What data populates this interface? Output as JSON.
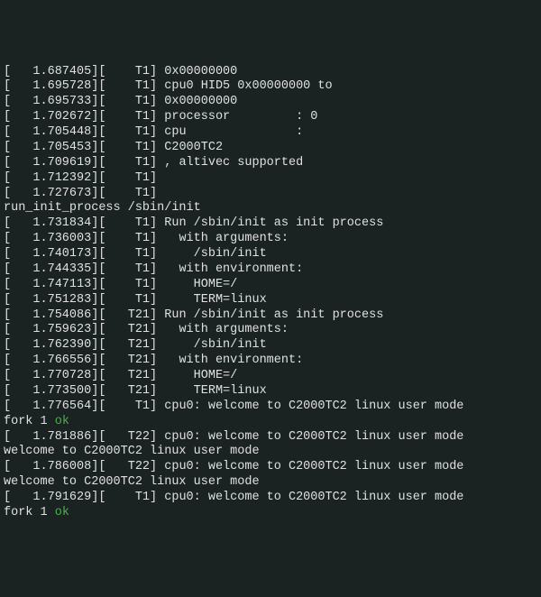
{
  "lines": [
    {
      "type": "log",
      "ts": "1.687405",
      "thread": "T1",
      "msg": "0x00000000"
    },
    {
      "type": "log",
      "ts": "1.695728",
      "thread": "T1",
      "msg": "cpu0 HID5 0x00000000 to"
    },
    {
      "type": "log",
      "ts": "1.695733",
      "thread": "T1",
      "msg": "0x00000000"
    },
    {
      "type": "log",
      "ts": "1.702672",
      "thread": "T1",
      "msg": "processor         : 0"
    },
    {
      "type": "log",
      "ts": "1.705448",
      "thread": "T1",
      "msg": "cpu               :"
    },
    {
      "type": "log",
      "ts": "1.705453",
      "thread": "T1",
      "msg": "C2000TC2"
    },
    {
      "type": "log",
      "ts": "1.709619",
      "thread": "T1",
      "msg": ", altivec supported"
    },
    {
      "type": "log",
      "ts": "1.712392",
      "thread": "T1",
      "msg": ""
    },
    {
      "type": "log",
      "ts": "1.727673",
      "thread": "T1",
      "msg": ""
    },
    {
      "type": "plain",
      "text": "run_init_process /sbin/init"
    },
    {
      "type": "log",
      "ts": "1.731834",
      "thread": "T1",
      "msg": "Run /sbin/init as init process"
    },
    {
      "type": "log",
      "ts": "1.736003",
      "thread": "T1",
      "msg": "  with arguments:"
    },
    {
      "type": "log",
      "ts": "1.740173",
      "thread": "T1",
      "msg": "    /sbin/init"
    },
    {
      "type": "log",
      "ts": "1.744335",
      "thread": "T1",
      "msg": "  with environment:"
    },
    {
      "type": "log",
      "ts": "1.747113",
      "thread": "T1",
      "msg": "    HOME=/"
    },
    {
      "type": "log",
      "ts": "1.751283",
      "thread": "T1",
      "msg": "    TERM=linux"
    },
    {
      "type": "log",
      "ts": "1.754086",
      "thread": "T21",
      "msg": "Run /sbin/init as init process"
    },
    {
      "type": "log",
      "ts": "1.759623",
      "thread": "T21",
      "msg": "  with arguments:"
    },
    {
      "type": "log",
      "ts": "1.762390",
      "thread": "T21",
      "msg": "    /sbin/init"
    },
    {
      "type": "log",
      "ts": "1.766556",
      "thread": "T21",
      "msg": "  with environment:"
    },
    {
      "type": "log",
      "ts": "1.770728",
      "thread": "T21",
      "msg": "    HOME=/"
    },
    {
      "type": "log",
      "ts": "1.773500",
      "thread": "T21",
      "msg": "    TERM=linux"
    },
    {
      "type": "log",
      "ts": "1.776564",
      "thread": "T1",
      "msg": "cpu0: welcome to C2000TC2 linux user mode"
    },
    {
      "type": "fork",
      "prefix": "fork 1 ",
      "status": "ok"
    },
    {
      "type": "log",
      "ts": "1.781886",
      "thread": "T22",
      "msg": "cpu0: welcome to C2000TC2 linux user mode"
    },
    {
      "type": "plain",
      "text": "welcome to C2000TC2 linux user mode"
    },
    {
      "type": "log",
      "ts": "1.786008",
      "thread": "T22",
      "msg": "cpu0: welcome to C2000TC2 linux user mode"
    },
    {
      "type": "plain",
      "text": "welcome to C2000TC2 linux user mode"
    },
    {
      "type": "log",
      "ts": "1.791629",
      "thread": "T1",
      "msg": "cpu0: welcome to C2000TC2 linux user mode"
    },
    {
      "type": "fork",
      "prefix": "fork 1 ",
      "status": "ok"
    }
  ]
}
